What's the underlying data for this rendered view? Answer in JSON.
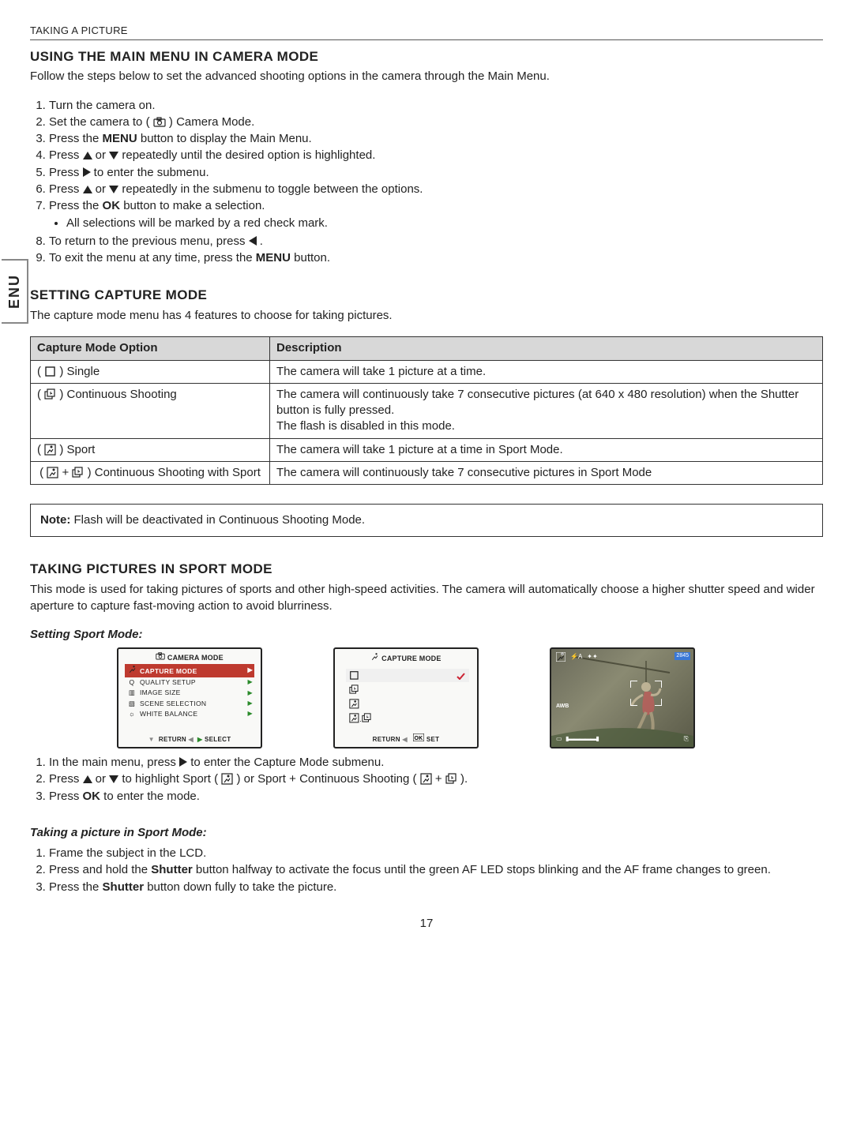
{
  "sideTab": "ENU",
  "breadcrumb": "TAKING A PICTURE",
  "section1": {
    "title": "USING THE MAIN MENU IN CAMERA MODE",
    "intro": "Follow the steps below to set the advanced shooting options in the camera through the Main Menu.",
    "steps": {
      "s1": "Turn the camera on.",
      "s2a": "Set the camera to ( ",
      "s2b": " ) Camera Mode.",
      "s3a": "Press the ",
      "s3b": "MENU",
      "s3c": " button to display the Main Menu.",
      "s4a": "Press ",
      "s4b": " or ",
      "s4c": " repeatedly until the desired option is highlighted.",
      "s5a": "Press ",
      "s5b": " to enter the submenu.",
      "s6a": "Press ",
      "s6b": " or ",
      "s6c": " repeatedly in the submenu to toggle between the options.",
      "s7a": "Press the ",
      "s7b": "OK",
      "s7c": " button to make a selection.",
      "s7bullet": "All selections will be marked by a red check mark.",
      "s8a": "To return to the previous menu, press ",
      "s8b": " .",
      "s9a": "To exit the menu at any time, press the ",
      "s9b": "MENU",
      "s9c": " button."
    }
  },
  "section2": {
    "title": "SETTING CAPTURE MODE",
    "intro": "The capture mode menu has 4 features to choose for taking pictures.",
    "tableHeaders": {
      "opt": "Capture Mode Option",
      "desc": "Description"
    },
    "rows": {
      "r1": {
        "label": " ) Single",
        "desc": "The camera will take 1 picture at a time."
      },
      "r2": {
        "label": " ) Continuous Shooting",
        "desc": "The camera will continuously take 7 consecutive pictures (at 640 x 480 resolution) when the Shutter button is fully pressed.\nThe flash is disabled in this mode."
      },
      "r3": {
        "label": " ) Sport",
        "desc": "The camera will take 1 picture at a time in Sport Mode."
      },
      "r4": {
        "label": " ) Continuous Shooting with Sport",
        "desc": "The camera will continuously take 7 consecutive pictures in Sport Mode"
      }
    },
    "noteLabel": "Note:",
    "noteText": " Flash will be deactivated in Continuous Shooting Mode."
  },
  "section3": {
    "title": "TAKING PICTURES IN SPORT MODE",
    "intro": "This mode is used for taking pictures of sports and other high-speed activities. The camera will automatically choose a higher shutter speed and wider aperture to capture fast-moving action to avoid blurriness.",
    "sub1": "Setting Sport Mode:",
    "menu1": {
      "title": "CAMERA MODE",
      "items": [
        "CAPTURE MODE",
        "QUALITY SETUP",
        "IMAGE SIZE",
        "SCENE SELECTION",
        "WHITE BALANCE"
      ],
      "footerReturn": "RETURN",
      "footerSelect": "SELECT"
    },
    "menu2": {
      "title": "CAPTURE MODE",
      "footerReturn": "RETURN",
      "footerSet": "SET"
    },
    "preview": {
      "counter": "2845",
      "awb": "AWB"
    },
    "steps1": {
      "s1a": "In the main menu, press ",
      "s1b": " to enter the Capture Mode submenu.",
      "s2a": "Press ",
      "s2b": " or ",
      "s2c": " to highlight Sport ( ",
      "s2d": " ) or Sport + Continuous Shooting ( ",
      "s2e": " ).",
      "s3a": "Press ",
      "s3b": "OK",
      "s3c": " to enter the mode."
    },
    "sub2": "Taking a picture in Sport Mode:",
    "steps2": {
      "s1": "Frame the subject in the LCD.",
      "s2a": "Press and hold the ",
      "s2b": "Shutter",
      "s2c": " button halfway to activate the focus until the green AF LED stops blinking and the AF frame changes to green.",
      "s3a": "Press the ",
      "s3b": "Shutter",
      "s3c": " button down fully to take the picture."
    }
  },
  "pageNumber": "17"
}
